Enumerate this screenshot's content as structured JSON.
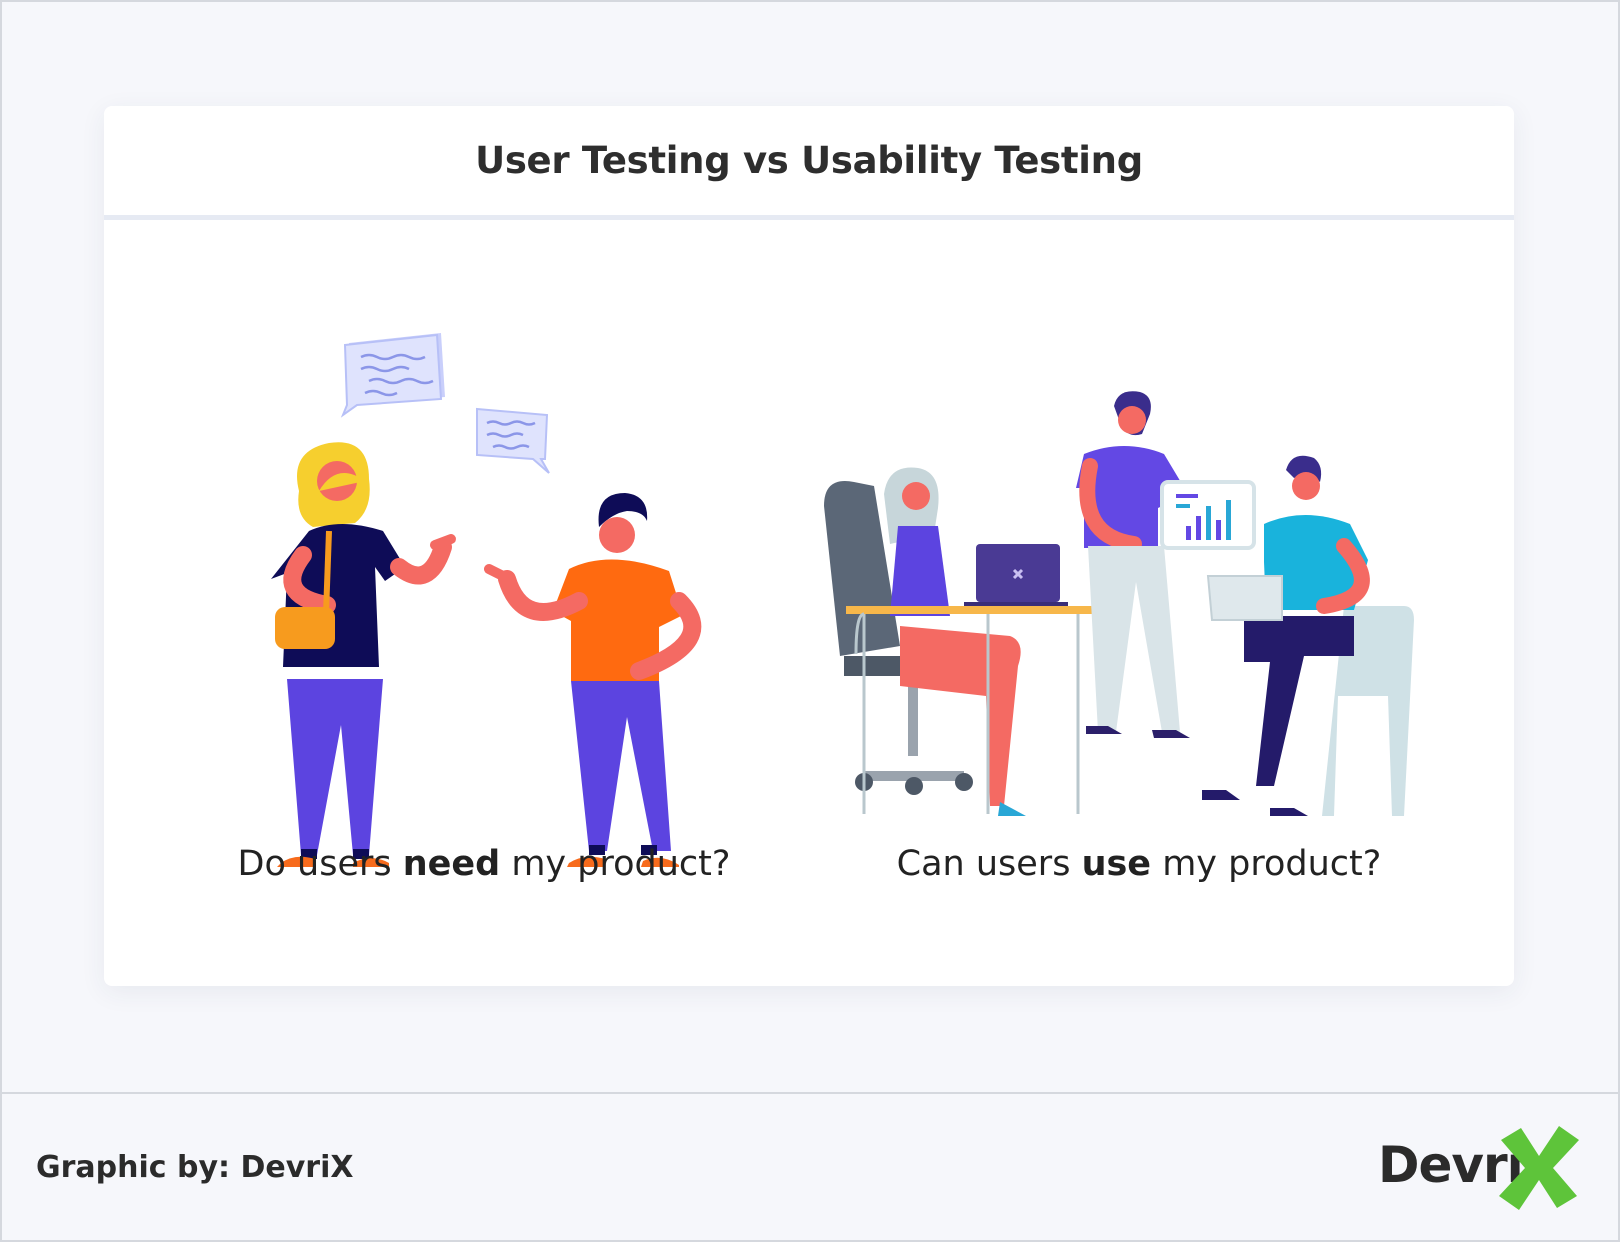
{
  "title": "User Testing vs Usability Testing",
  "left_caption": {
    "before": "Do users ",
    "bold": "need",
    "after": " my product?"
  },
  "right_caption": {
    "before": "Can users ",
    "bold": "use",
    "after": " my product?"
  },
  "footer": {
    "credit": "Graphic by: DevriX"
  },
  "logo": {
    "text": "Devri",
    "mark": "X",
    "mark_color": "#5ec43a"
  },
  "colors": {
    "background": "#f6f7fb",
    "card": "#ffffff",
    "divider": "#e6eaf3"
  }
}
